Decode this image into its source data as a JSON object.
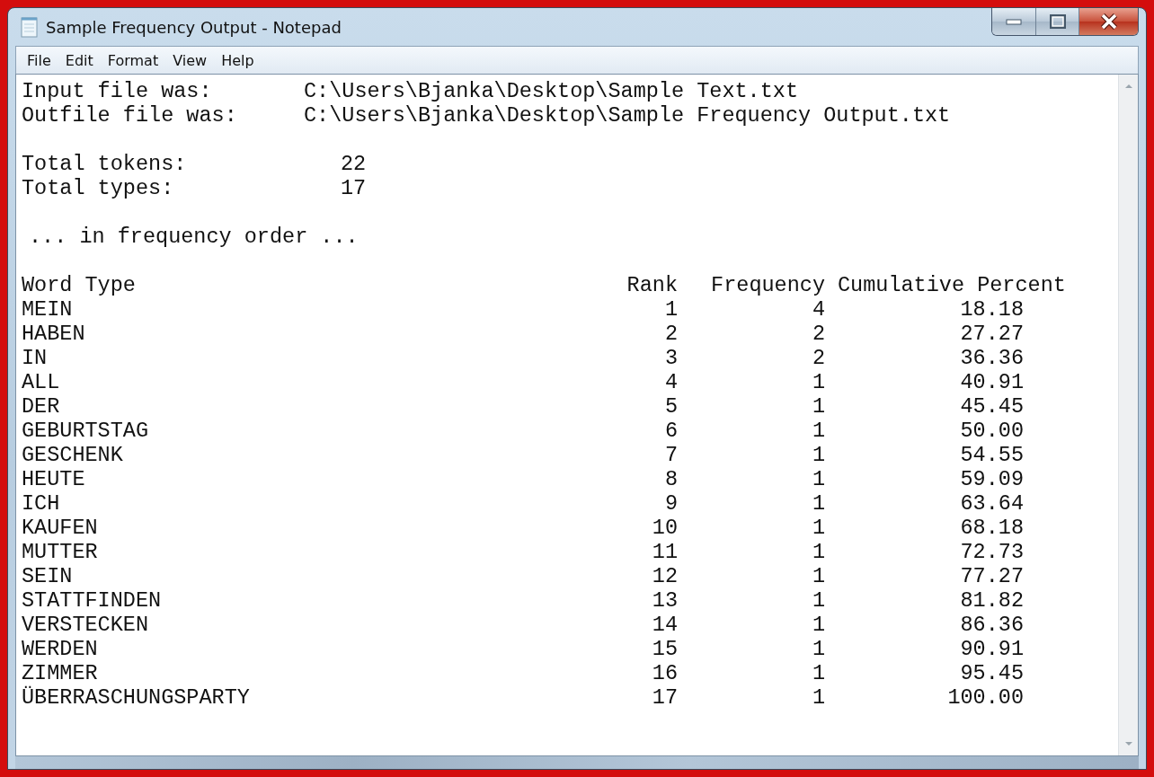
{
  "window": {
    "title": "Sample Frequency Output - Notepad"
  },
  "menu": [
    "File",
    "Edit",
    "Format",
    "View",
    "Help"
  ],
  "document": {
    "files": [
      {
        "label": "Input file was:",
        "value": "C:\\Users\\Bjanka\\Desktop\\Sample Text.txt"
      },
      {
        "label": "Outfile file was:",
        "value": "C:\\Users\\Bjanka\\Desktop\\Sample Frequency Output.txt"
      }
    ],
    "totals": [
      {
        "label": "Total tokens:",
        "value": "22"
      },
      {
        "label": "Total types:",
        "value": "17"
      }
    ],
    "note": "... in frequency order ...",
    "table": {
      "columns": [
        "Word Type",
        "Rank",
        "Frequency",
        "Cumulative Percent"
      ],
      "rows": [
        [
          "MEIN",
          "1",
          "4",
          "18.18"
        ],
        [
          "HABEN",
          "2",
          "2",
          "27.27"
        ],
        [
          "IN",
          "3",
          "2",
          "36.36"
        ],
        [
          "ALL",
          "4",
          "1",
          "40.91"
        ],
        [
          "DER",
          "5",
          "1",
          "45.45"
        ],
        [
          "GEBURTSTAG",
          "6",
          "1",
          "50.00"
        ],
        [
          "GESCHENK",
          "7",
          "1",
          "54.55"
        ],
        [
          "HEUTE",
          "8",
          "1",
          "59.09"
        ],
        [
          "ICH",
          "9",
          "1",
          "63.64"
        ],
        [
          "KAUFEN",
          "10",
          "1",
          "68.18"
        ],
        [
          "MUTTER",
          "11",
          "1",
          "72.73"
        ],
        [
          "SEIN",
          "12",
          "1",
          "77.27"
        ],
        [
          "STATTFINDEN",
          "13",
          "1",
          "81.82"
        ],
        [
          "VERSTECKEN",
          "14",
          "1",
          "86.36"
        ],
        [
          "WERDEN",
          "15",
          "1",
          "90.91"
        ],
        [
          "ZIMMER",
          "16",
          "1",
          "95.45"
        ],
        [
          "ÜBERRASCHUNGSPARTY",
          "17",
          "1",
          "100.00"
        ]
      ]
    }
  }
}
